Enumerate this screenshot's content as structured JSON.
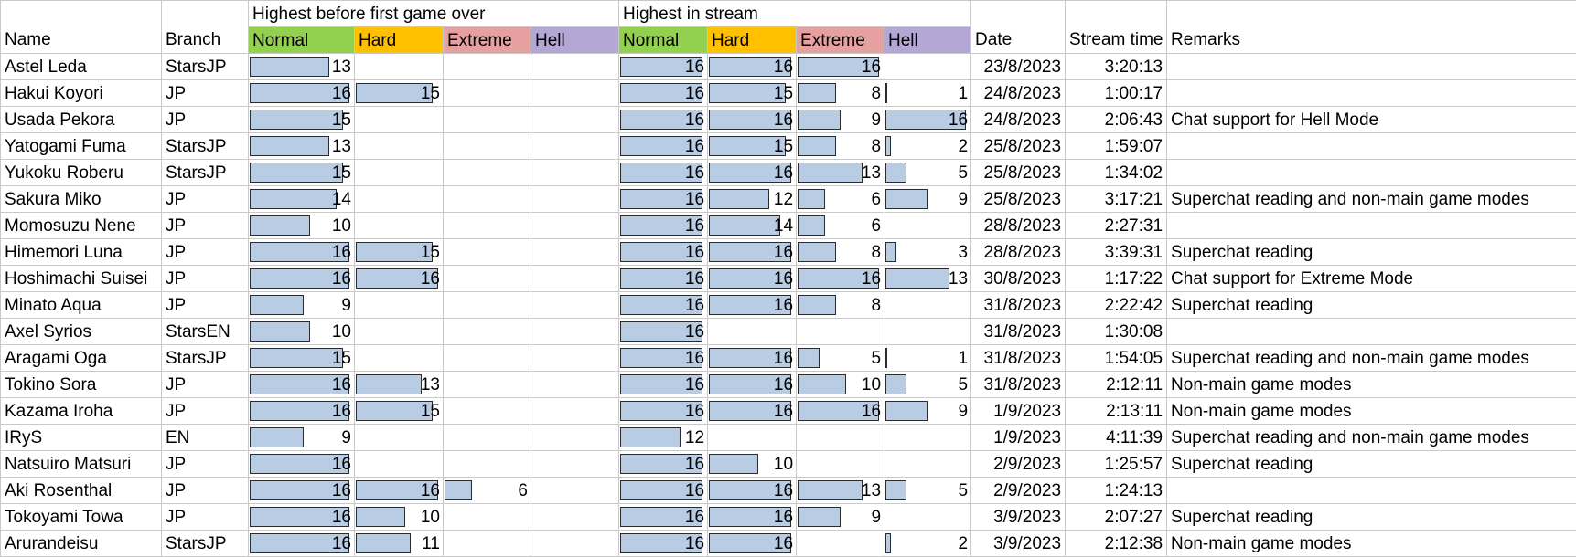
{
  "header": {
    "group_before": "Highest before first game over",
    "group_stream": "Highest in stream",
    "columns": {
      "name": "Name",
      "branch": "Branch",
      "normal": "Normal",
      "hard": "Hard",
      "extreme": "Extreme",
      "hell": "Hell",
      "date": "Date",
      "stream_time": "Stream time",
      "remarks": "Remarks"
    },
    "colors": {
      "normal": "#92d050",
      "hard": "#ffc000",
      "extreme": "#e6a0a0",
      "hell": "#b4a7d6",
      "bar": "#b8cce4"
    }
  },
  "max_value": 16,
  "rows": [
    {
      "name": "Astel Leda",
      "branch": "StarsJP",
      "before": [
        13,
        null,
        null,
        null
      ],
      "stream": [
        16,
        16,
        16,
        null
      ],
      "date": "23/8/2023",
      "time": "3:20:13",
      "remarks": ""
    },
    {
      "name": "Hakui Koyori",
      "branch": "JP",
      "before": [
        16,
        15,
        null,
        null
      ],
      "stream": [
        16,
        15,
        8,
        1
      ],
      "date": "24/8/2023",
      "time": "1:00:17",
      "remarks": ""
    },
    {
      "name": "Usada Pekora",
      "branch": "JP",
      "before": [
        15,
        null,
        null,
        null
      ],
      "stream": [
        16,
        16,
        9,
        16
      ],
      "date": "24/8/2023",
      "time": "2:06:43",
      "remarks": "Chat support for Hell Mode"
    },
    {
      "name": "Yatogami Fuma",
      "branch": "StarsJP",
      "before": [
        13,
        null,
        null,
        null
      ],
      "stream": [
        16,
        15,
        8,
        2
      ],
      "date": "25/8/2023",
      "time": "1:59:07",
      "remarks": ""
    },
    {
      "name": "Yukoku Roberu",
      "branch": "StarsJP",
      "before": [
        15,
        null,
        null,
        null
      ],
      "stream": [
        16,
        16,
        13,
        5
      ],
      "date": "25/8/2023",
      "time": "1:34:02",
      "remarks": ""
    },
    {
      "name": "Sakura Miko",
      "branch": "JP",
      "before": [
        14,
        null,
        null,
        null
      ],
      "stream": [
        16,
        12,
        6,
        9
      ],
      "date": "25/8/2023",
      "time": "3:17:21",
      "remarks": "Superchat reading and non-main game modes"
    },
    {
      "name": "Momosuzu Nene",
      "branch": "JP",
      "before": [
        10,
        null,
        null,
        null
      ],
      "stream": [
        16,
        14,
        6,
        null
      ],
      "date": "28/8/2023",
      "time": "2:27:31",
      "remarks": ""
    },
    {
      "name": "Himemori Luna",
      "branch": "JP",
      "before": [
        16,
        15,
        null,
        null
      ],
      "stream": [
        16,
        16,
        8,
        3
      ],
      "date": "28/8/2023",
      "time": "3:39:31",
      "remarks": "Superchat reading"
    },
    {
      "name": "Hoshimachi Suisei",
      "branch": "JP",
      "before": [
        16,
        16,
        null,
        null
      ],
      "stream": [
        16,
        16,
        16,
        13
      ],
      "date": "30/8/2023",
      "time": "1:17:22",
      "remarks": "Chat support for Extreme Mode"
    },
    {
      "name": "Minato Aqua",
      "branch": "JP",
      "before": [
        9,
        null,
        null,
        null
      ],
      "stream": [
        16,
        16,
        8,
        null
      ],
      "date": "31/8/2023",
      "time": "2:22:42",
      "remarks": "Superchat reading"
    },
    {
      "name": "Axel Syrios",
      "branch": "StarsEN",
      "before": [
        10,
        null,
        null,
        null
      ],
      "stream": [
        16,
        null,
        null,
        null
      ],
      "date": "31/8/2023",
      "time": "1:30:08",
      "remarks": ""
    },
    {
      "name": "Aragami Oga",
      "branch": "StarsJP",
      "before": [
        15,
        null,
        null,
        null
      ],
      "stream": [
        16,
        16,
        5,
        1
      ],
      "date": "31/8/2023",
      "time": "1:54:05",
      "remarks": "Superchat reading and non-main game modes"
    },
    {
      "name": "Tokino Sora",
      "branch": "JP",
      "before": [
        16,
        13,
        null,
        null
      ],
      "stream": [
        16,
        16,
        10,
        5
      ],
      "date": "31/8/2023",
      "time": "2:12:11",
      "remarks": "Non-main game modes"
    },
    {
      "name": "Kazama Iroha",
      "branch": "JP",
      "before": [
        16,
        15,
        null,
        null
      ],
      "stream": [
        16,
        16,
        16,
        9
      ],
      "date": "1/9/2023",
      "time": "2:13:11",
      "remarks": "Non-main game modes"
    },
    {
      "name": "IRyS",
      "branch": "EN",
      "before": [
        9,
        null,
        null,
        null
      ],
      "stream": [
        12,
        null,
        null,
        null
      ],
      "date": "1/9/2023",
      "time": "4:11:39",
      "remarks": "Superchat reading and non-main game modes"
    },
    {
      "name": "Natsuiro Matsuri",
      "branch": "JP",
      "before": [
        16,
        null,
        null,
        null
      ],
      "stream": [
        16,
        10,
        null,
        null
      ],
      "date": "2/9/2023",
      "time": "1:25:57",
      "remarks": "Superchat reading"
    },
    {
      "name": "Aki Rosenthal",
      "branch": "JP",
      "before": [
        16,
        16,
        6,
        null
      ],
      "stream": [
        16,
        16,
        13,
        5
      ],
      "date": "2/9/2023",
      "time": "1:24:13",
      "remarks": ""
    },
    {
      "name": "Tokoyami Towa",
      "branch": "JP",
      "before": [
        16,
        10,
        null,
        null
      ],
      "stream": [
        16,
        16,
        9,
        null
      ],
      "date": "3/9/2023",
      "time": "2:07:27",
      "remarks": "Superchat reading"
    },
    {
      "name": "Arurandeisu",
      "branch": "StarsJP",
      "before": [
        16,
        11,
        null,
        null
      ],
      "stream": [
        16,
        16,
        null,
        2
      ],
      "date": "3/9/2023",
      "time": "2:12:38",
      "remarks": "Non-main game modes"
    }
  ]
}
